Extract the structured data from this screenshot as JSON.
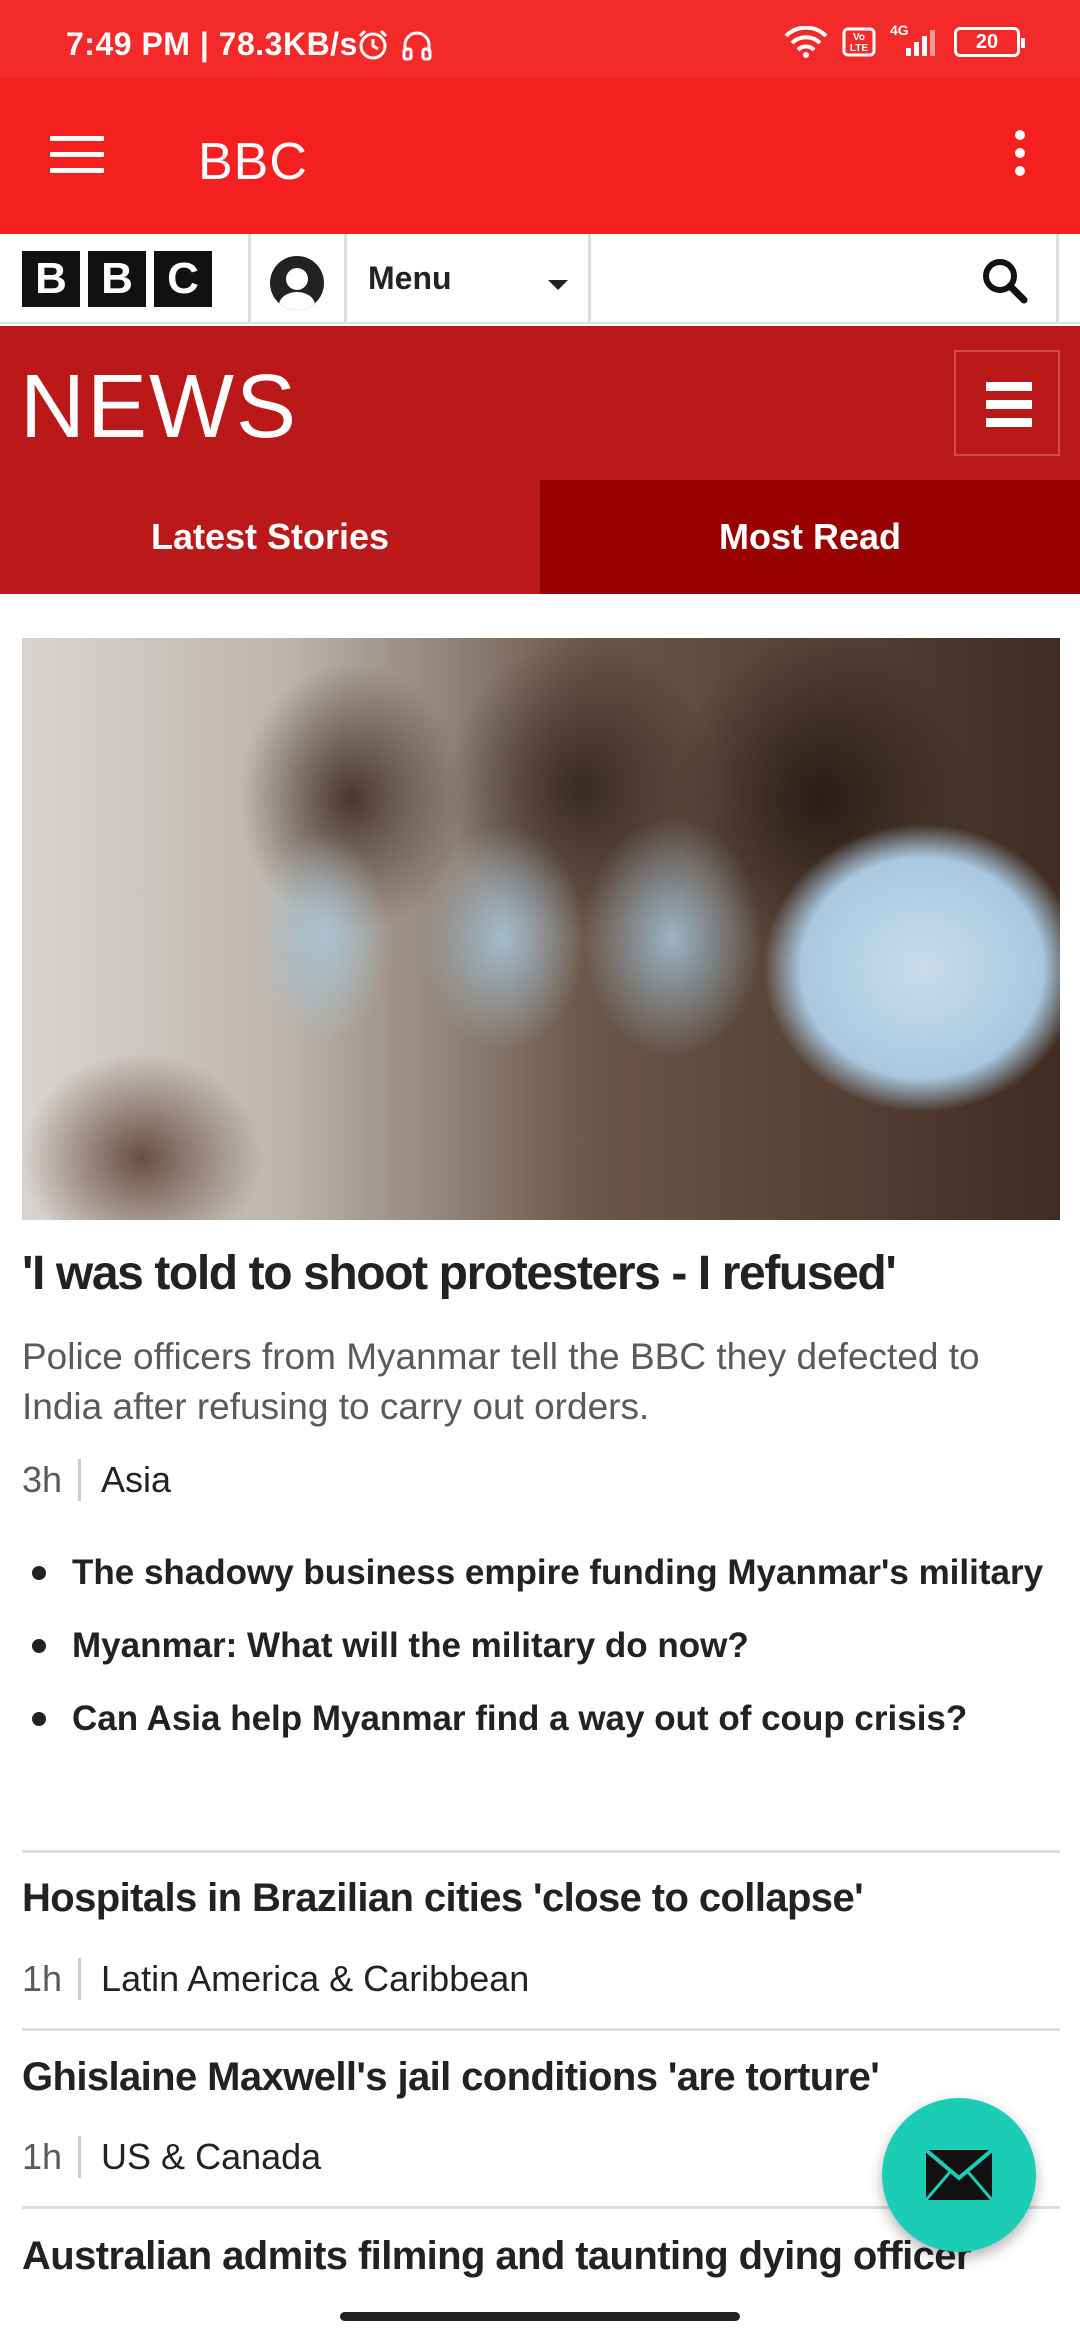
{
  "status_bar": {
    "time_speed": "7:49 PM | 78.3KB/s",
    "network": "4G",
    "battery": "20"
  },
  "app_bar": {
    "title": "BBC"
  },
  "bbc_bar": {
    "logo_letters": [
      "B",
      "B",
      "C"
    ],
    "menu_label": "Menu"
  },
  "news_header": {
    "logo_text": "NEWS",
    "tabs": [
      {
        "label": "Latest Stories"
      },
      {
        "label": "Most Read"
      }
    ]
  },
  "lead_story": {
    "headline": "'I was told to shoot protesters - I refused'",
    "summary": "Police officers from Myanmar tell the BBC they defected to India after refusing to carry out orders.",
    "time": "3h",
    "category": "Asia",
    "related": [
      "The shadowy business empire funding Myanmar's military",
      "Myanmar: What will the military do now?",
      "Can Asia help Myanmar find a way out of coup crisis?"
    ]
  },
  "stories": [
    {
      "headline": "Hospitals in Brazilian cities 'close to collapse'",
      "time": "1h",
      "category": "Latin America & Caribbean"
    },
    {
      "headline": "Ghislaine Maxwell's jail conditions 'are torture'",
      "time": "1h",
      "category": "US & Canada"
    },
    {
      "headline": "Australian admits filming and taunting dying officer"
    }
  ],
  "colors": {
    "app_bar": "#f42020",
    "news_red": "#bb1919",
    "tab_active": "#990000",
    "fab": "#1ccdb6"
  },
  "icons": {
    "fab": "envelope-icon",
    "search": "search-icon",
    "drawer": "hamburger-icon",
    "overflow": "kebab-icon"
  }
}
